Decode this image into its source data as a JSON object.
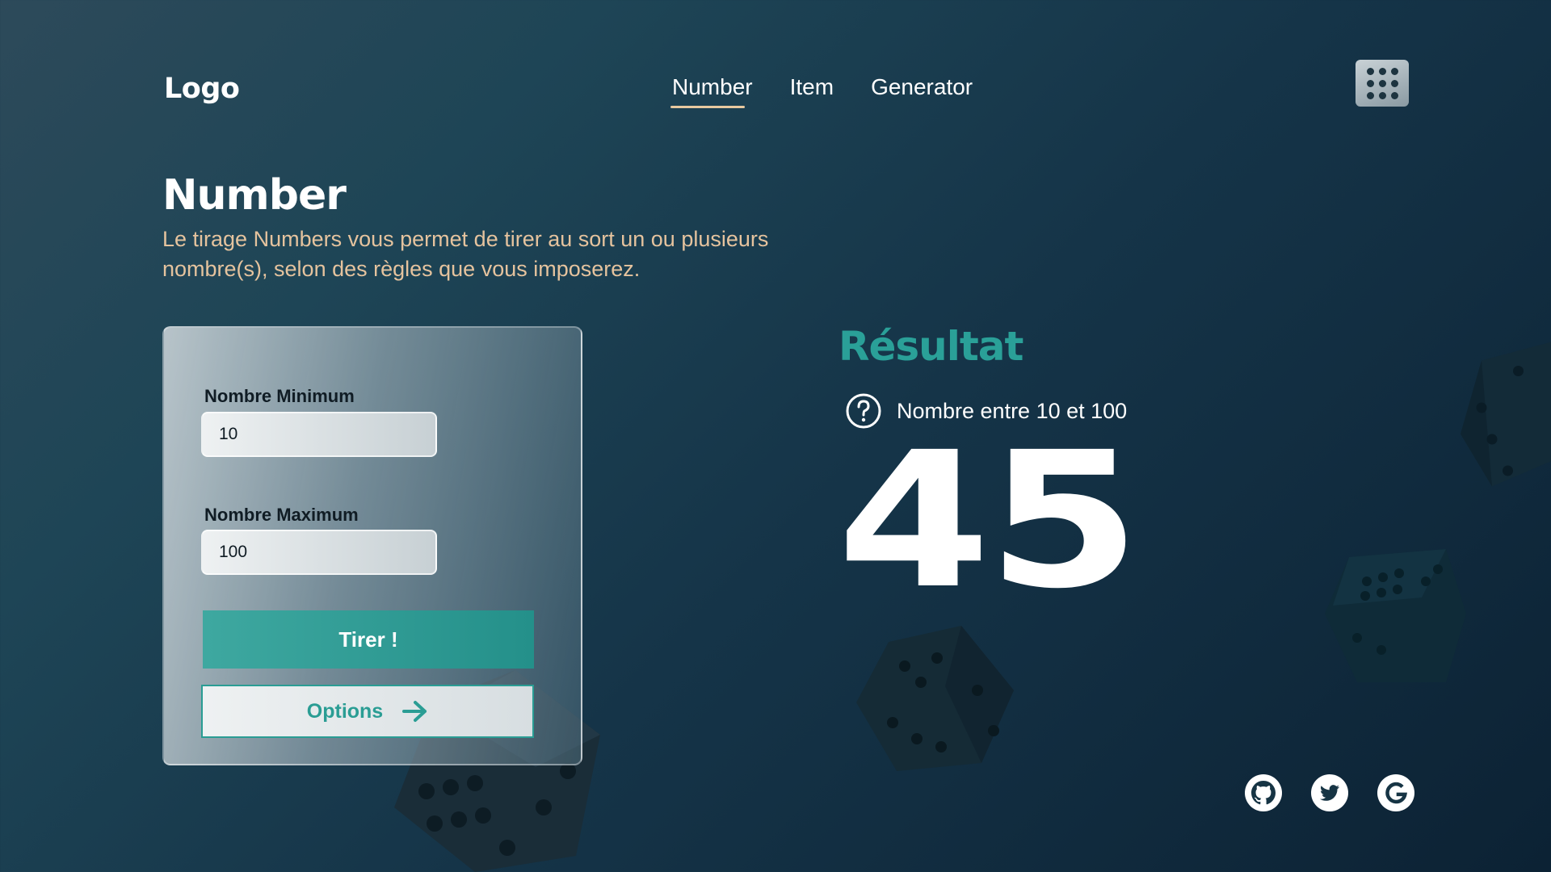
{
  "header": {
    "logo": "Logo",
    "nav": [
      {
        "label": "Number",
        "active": true
      },
      {
        "label": "Item",
        "active": false
      },
      {
        "label": "Generator",
        "active": false
      }
    ],
    "menu_icon": "grid-dots-icon"
  },
  "main": {
    "title": "Number",
    "description": "Le tirage Numbers vous permet de tirer au sort un ou plusieurs nombre(s), selon des règles que vous imposerez."
  },
  "form": {
    "min_label": "Nombre Minimum",
    "min_value": "10",
    "max_label": "Nombre Maximum",
    "max_value": "100",
    "draw_label": "Tirer !",
    "options_label": "Options",
    "options_icon": "arrow-right-icon"
  },
  "result": {
    "title": "Résultat",
    "hint_icon": "question-circle-icon",
    "hint": "Nombre entre 10 et 100",
    "value": "45"
  },
  "footer": {
    "social": [
      {
        "icon": "github-icon"
      },
      {
        "icon": "twitter-icon"
      },
      {
        "icon": "google-icon"
      }
    ]
  },
  "colors": {
    "accent": "#2aa098",
    "description": "#e5c39e",
    "text": "#ffffff"
  }
}
